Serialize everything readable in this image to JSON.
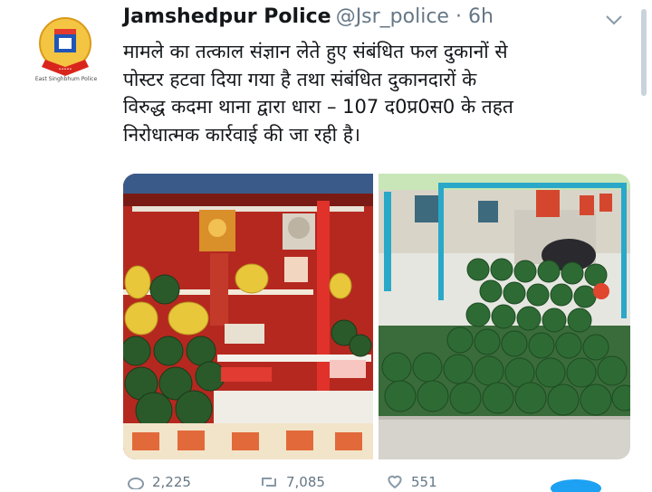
{
  "tweet": {
    "author_name": "Jamshedpur Police",
    "handle_time": "@Jsr_police · 6h",
    "text_lines": [
      "मामले का तत्काल संज्ञान लेते हुए संबंधित फल दुकानों से",
      "पोस्टर हटवा दिया गया है तथा संबंधित दुकानदारों के",
      "विरुद्ध कदमा थाना द्वारा धारा – 107 द0प्र0स0 के तहत",
      "निरोधात्मक कार्रवाई की जा रही है।"
    ]
  },
  "avatar": {
    "caption": "East Singhbhum Police"
  },
  "actions": {
    "reply_count": "2,225",
    "retweet_count": "7,085",
    "like_count": "551"
  },
  "colors": {
    "text": "#14171a",
    "muted": "#657786",
    "accent": "#1da1f2"
  }
}
